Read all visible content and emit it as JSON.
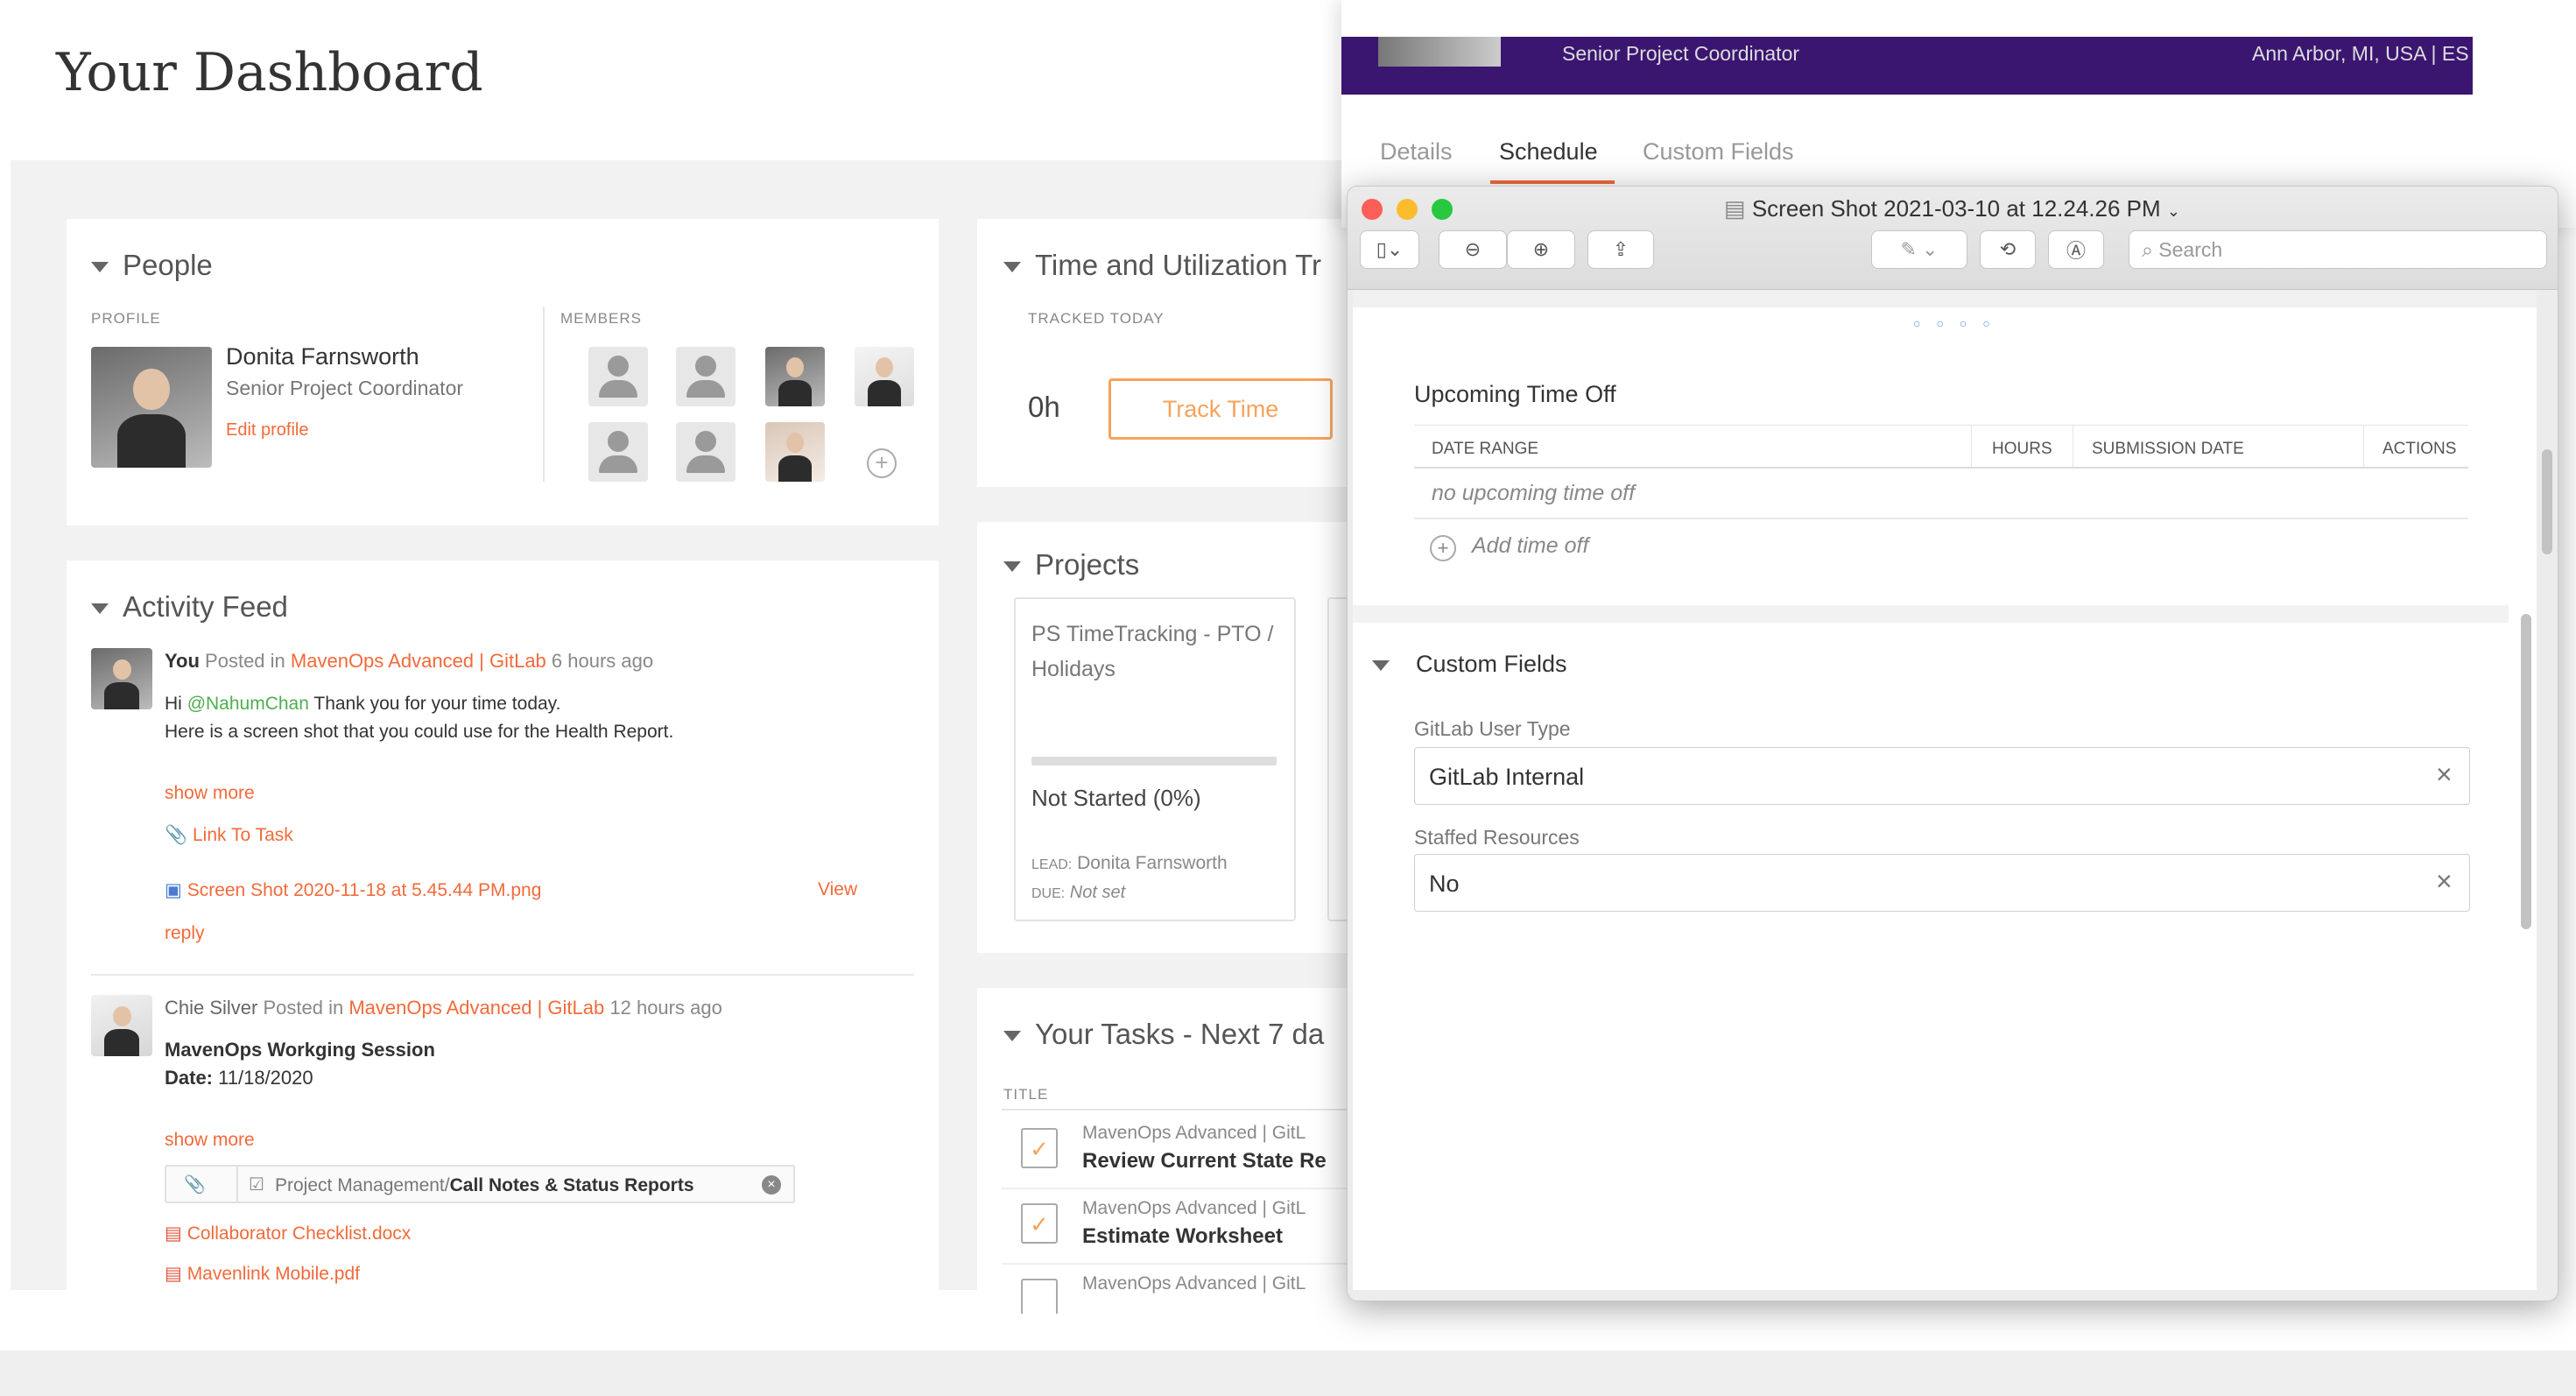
{
  "dashboard": {
    "title": "Your Dashboard",
    "people": {
      "title": "People",
      "profile_label": "PROFILE",
      "members_label": "MEMBERS",
      "name": "Donita Farnsworth",
      "role": "Senior Project Coordinator",
      "edit_link": "Edit profile"
    },
    "activity": {
      "title": "Activity Feed",
      "post1": {
        "author": "You",
        "posted_in": "Posted in",
        "project": "MavenOps Advanced | GitLab",
        "time": "6 hours ago",
        "greeting_prefix": "Hi",
        "mention": "@NahumChan",
        "line1_rest": "Thank you for your time today.",
        "line2": "Here is a screen shot that you could use for the Health Report.",
        "show_more": "show more",
        "link_task": "Link To Task",
        "attachment": "Screen Shot 2020-11-18 at 5.45.44 PM.png",
        "view": "View",
        "reply": "reply"
      },
      "post2": {
        "author": "Chie Silver",
        "posted_in": "Posted in",
        "project": "MavenOps Advanced | GitLab",
        "time": "12 hours ago",
        "subject": "MavenOps Workging Session",
        "date_label": "Date:",
        "date": "11/18/2020",
        "show_more": "show more",
        "path_prefix": "Project Management/",
        "path_bold": "Call Notes & Status Reports",
        "file1": "Collaborator Checklist.docx",
        "file2": "Mavenlink Mobile.pdf"
      }
    },
    "time": {
      "title": "Time and Utilization Tr",
      "tracked_label": "TRACKED TODAY",
      "hours": "0h",
      "track_button": "Track Time"
    },
    "projects": {
      "title": "Projects",
      "card_title": "PS TimeTracking - PTO / Holidays",
      "status": "Not Started (0%)",
      "progress": 0,
      "lead_label": "LEAD:",
      "lead": "Donita Farnsworth",
      "due_label": "DUE:",
      "due": "Not set"
    },
    "tasks": {
      "title": "Your Tasks - Next 7 da",
      "col_title": "TITLE",
      "items": [
        {
          "project": "MavenOps Advanced | GitL",
          "name": "Review Current State Re"
        },
        {
          "project": "MavenOps Advanced | GitL",
          "name": "Estimate Worksheet"
        },
        {
          "project": "MavenOps Advanced | GitL",
          "name": ""
        }
      ]
    }
  },
  "profile_panel": {
    "header_role": "Senior Project Coordinator",
    "header_location": "Ann Arbor, MI, USA | ES",
    "tabs": [
      "Details",
      "Schedule",
      "Custom Fields"
    ],
    "active_tab": "Schedule"
  },
  "preview": {
    "title": "Screen Shot 2021-03-10 at 12.24.26 PM",
    "search_placeholder": "Search",
    "upcoming": {
      "title": "Upcoming Time Off",
      "col_date": "DATE RANGE",
      "col_hours": "HOURS",
      "col_submission": "SUBMISSION DATE",
      "col_actions": "ACTIONS",
      "empty": "no upcoming time off",
      "add": "Add time off"
    },
    "custom_fields": {
      "title": "Custom Fields",
      "field1_label": "GitLab User Type",
      "field1_value": "GitLab Internal",
      "field2_label": "Staffed Resources",
      "field2_value": "No"
    }
  },
  "colors": {
    "accent_orange": "#f26a3a",
    "header_purple": "#3b1670",
    "mention_green": "#4fae4f"
  }
}
